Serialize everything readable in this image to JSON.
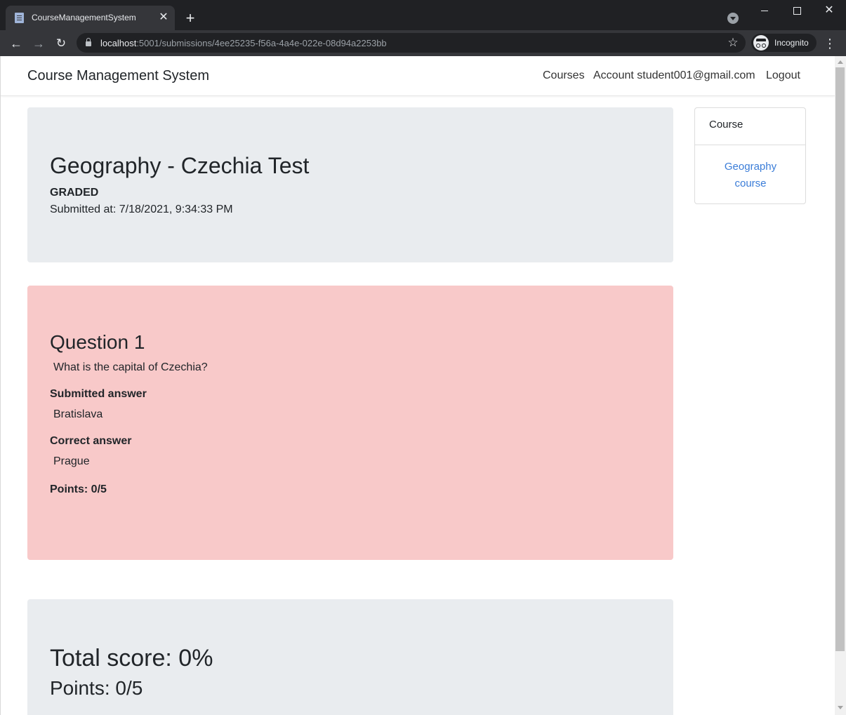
{
  "browser": {
    "tab_title": "CourseManagementSystem",
    "tab_close": "✕",
    "new_tab": "+",
    "url_host": "localhost",
    "url_rest": ":5001/submissions/4ee25235-f56a-4a4e-022e-08d94a2253bb",
    "profile_label": "Incognito",
    "icons": {
      "back": "arrow-left-icon",
      "forward": "arrow-right-icon",
      "reload": "reload-icon",
      "lock": "lock-icon",
      "star": "star-icon",
      "menu": "kebab-menu-icon"
    }
  },
  "navbar": {
    "brand": "Course Management System",
    "links": {
      "courses": "Courses",
      "account": "Account student001@gmail.com",
      "logout": "Logout"
    }
  },
  "submission": {
    "title": "Geography - Czechia Test",
    "status": "GRADED",
    "submitted_at": "Submitted at: 7/18/2021, 9:34:33 PM"
  },
  "question": {
    "title": "Question 1",
    "text": "What is the capital of Czechia?",
    "submitted_label": "Submitted answer",
    "submitted_answer": "Bratislava",
    "correct_label": "Correct answer",
    "correct_answer": "Prague",
    "points": "Points: 0/5",
    "background_color": "#f8c9c9"
  },
  "summary": {
    "total_score": "Total score: 0%",
    "points": "Points: 0/5"
  },
  "sidebar": {
    "header": "Course",
    "link": "Geography course",
    "link_color": "#3b7dd8"
  }
}
